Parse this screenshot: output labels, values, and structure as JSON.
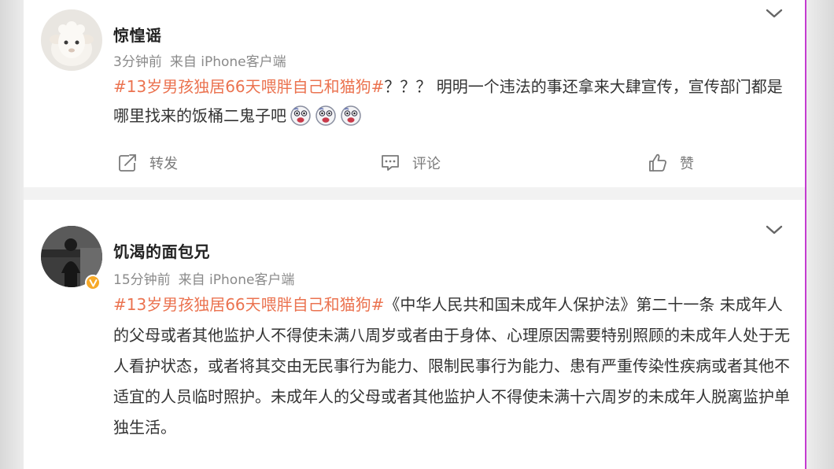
{
  "posts": [
    {
      "username": "惊惶谣",
      "time": "3分钟前",
      "source": "来自 iPhone客户端",
      "hashtag": "#13岁男孩独居66天喂胖自己和猫狗#",
      "text": "？？？ 明明一个违法的事还拿来大肆宣传，宣传部门都是哪里找来的饭桶二鬼子吧",
      "emoji_count": 3,
      "emoji_icon": "grimace-emoji-icon",
      "actions": {
        "repost": "转发",
        "comment": "评论",
        "like": "赞"
      }
    },
    {
      "username": "饥渴的面包兄",
      "time": "15分钟前",
      "source": "来自 iPhone客户端",
      "verified": true,
      "hashtag": "#13岁男孩独居66天喂胖自己和猫狗#",
      "text": "《中华人民共和国未成年人保护法》第二十一条 未成年人的父母或者其他监护人不得使未满八周岁或者由于身体、心理原因需要特别照顾的未成年人处于无人看护状态，或者将其交由无民事行为能力、限制民事行为能力、患有严重传染性疾病或者其他不适宜的人员临时照护。未成年人的父母或者其他监护人不得使未满十六周岁的未成年人脱离监护单独生活。"
    }
  ],
  "colors": {
    "hashtag": "#eb7350",
    "verified_badge": "#f7a928",
    "meta": "#8a8a8a",
    "body_text": "#333333"
  }
}
